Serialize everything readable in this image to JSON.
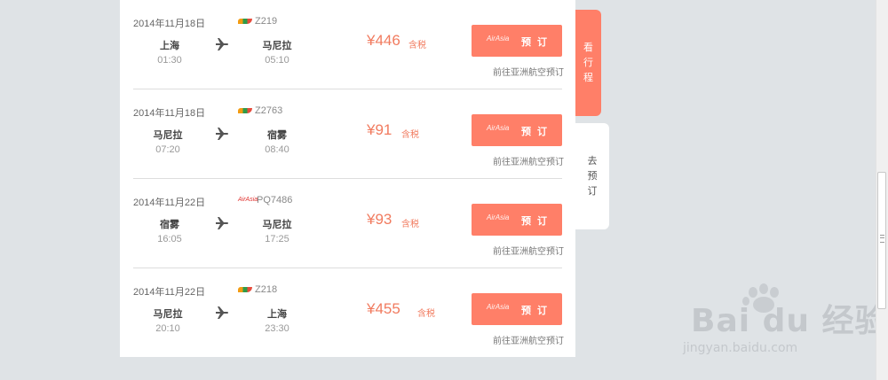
{
  "flights": [
    {
      "date": "2014年11月18日",
      "flight_no": "Z219",
      "airline_logo": "bird-logo",
      "from_city": "上海",
      "from_time": "01:30",
      "to_city": "马尼拉",
      "to_time": "05:10",
      "price": "¥446",
      "tax_label": "含税",
      "airline_mark": "AirAsia",
      "book_label": "预 订",
      "goto_label": "前往亚洲航空预订"
    },
    {
      "date": "2014年11月18日",
      "flight_no": "Z2763",
      "airline_logo": "bird-logo",
      "from_city": "马尼拉",
      "from_time": "07:20",
      "to_city": "宿雾",
      "to_time": "08:40",
      "price": "¥91",
      "tax_label": "含税",
      "airline_mark": "AirAsia",
      "book_label": "预 订",
      "goto_label": "前往亚洲航空预订"
    },
    {
      "date": "2014年11月22日",
      "flight_no": "PQ7486",
      "airline_logo": "script-logo",
      "airline_logo_text": "AirAsia",
      "from_city": "宿雾",
      "from_time": "16:05",
      "to_city": "马尼拉",
      "to_time": "17:25",
      "price": "¥93",
      "tax_label": "含税",
      "airline_mark": "AirAsia",
      "book_label": "预 订",
      "goto_label": "前往亚洲航空预订"
    },
    {
      "date": "2014年11月22日",
      "flight_no": "Z218",
      "airline_logo": "bird-logo",
      "from_city": "马尼拉",
      "from_time": "20:10",
      "to_city": "上海",
      "to_time": "23:30",
      "price": "¥455",
      "tax_label": "含税",
      "airline_mark": "AirAsia",
      "book_label": "预 订",
      "goto_label": "前往亚洲航空预订"
    }
  ],
  "side_tabs": {
    "view_itinerary": [
      "看",
      "行",
      "程"
    ],
    "go_book": [
      "去",
      "预",
      "订"
    ]
  },
  "watermark": {
    "brand": "Bai du 经验",
    "url": "jingyan.baidu.com"
  },
  "icons": {
    "plane": "plane-icon"
  },
  "colors": {
    "accent": "#ff7f68",
    "price": "#f17b5f",
    "background": "#dfe3e6"
  }
}
